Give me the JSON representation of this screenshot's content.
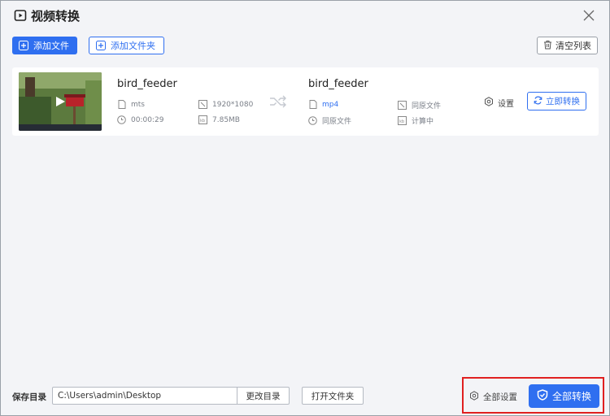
{
  "window": {
    "title": "视频转换"
  },
  "toolbar": {
    "add_file_label": "添加文件",
    "add_folder_label": "添加文件夹",
    "clear_list_label": "清空列表"
  },
  "file": {
    "source": {
      "name": "bird_feeder",
      "format": "mts",
      "resolution": "1920*1080",
      "duration": "00:00:29",
      "size": "7.85MB"
    },
    "target": {
      "name": "bird_feeder",
      "format": "mp4",
      "resolution": "同原文件",
      "folder": "同原文件",
      "size": "计算中"
    },
    "settings_label": "设置",
    "convert_now_label": "立即转换"
  },
  "footer": {
    "save_dir_label": "保存目录",
    "path_value": "C:\\Users\\admin\\Desktop",
    "change_dir_label": "更改目录",
    "open_folder_label": "打开文件夹",
    "all_settings_label": "全部设置",
    "all_convert_label": "全部转换"
  },
  "colors": {
    "accent": "#2f6ff0",
    "highlight": "#e02020"
  },
  "icons": [
    "app-icon",
    "close-icon",
    "plus-icon",
    "trash-icon",
    "play-icon",
    "file-icon",
    "resolution-icon",
    "clock-icon",
    "size-icon",
    "shuffle-icon",
    "gear-icon",
    "refresh-icon",
    "shield-icon"
  ]
}
